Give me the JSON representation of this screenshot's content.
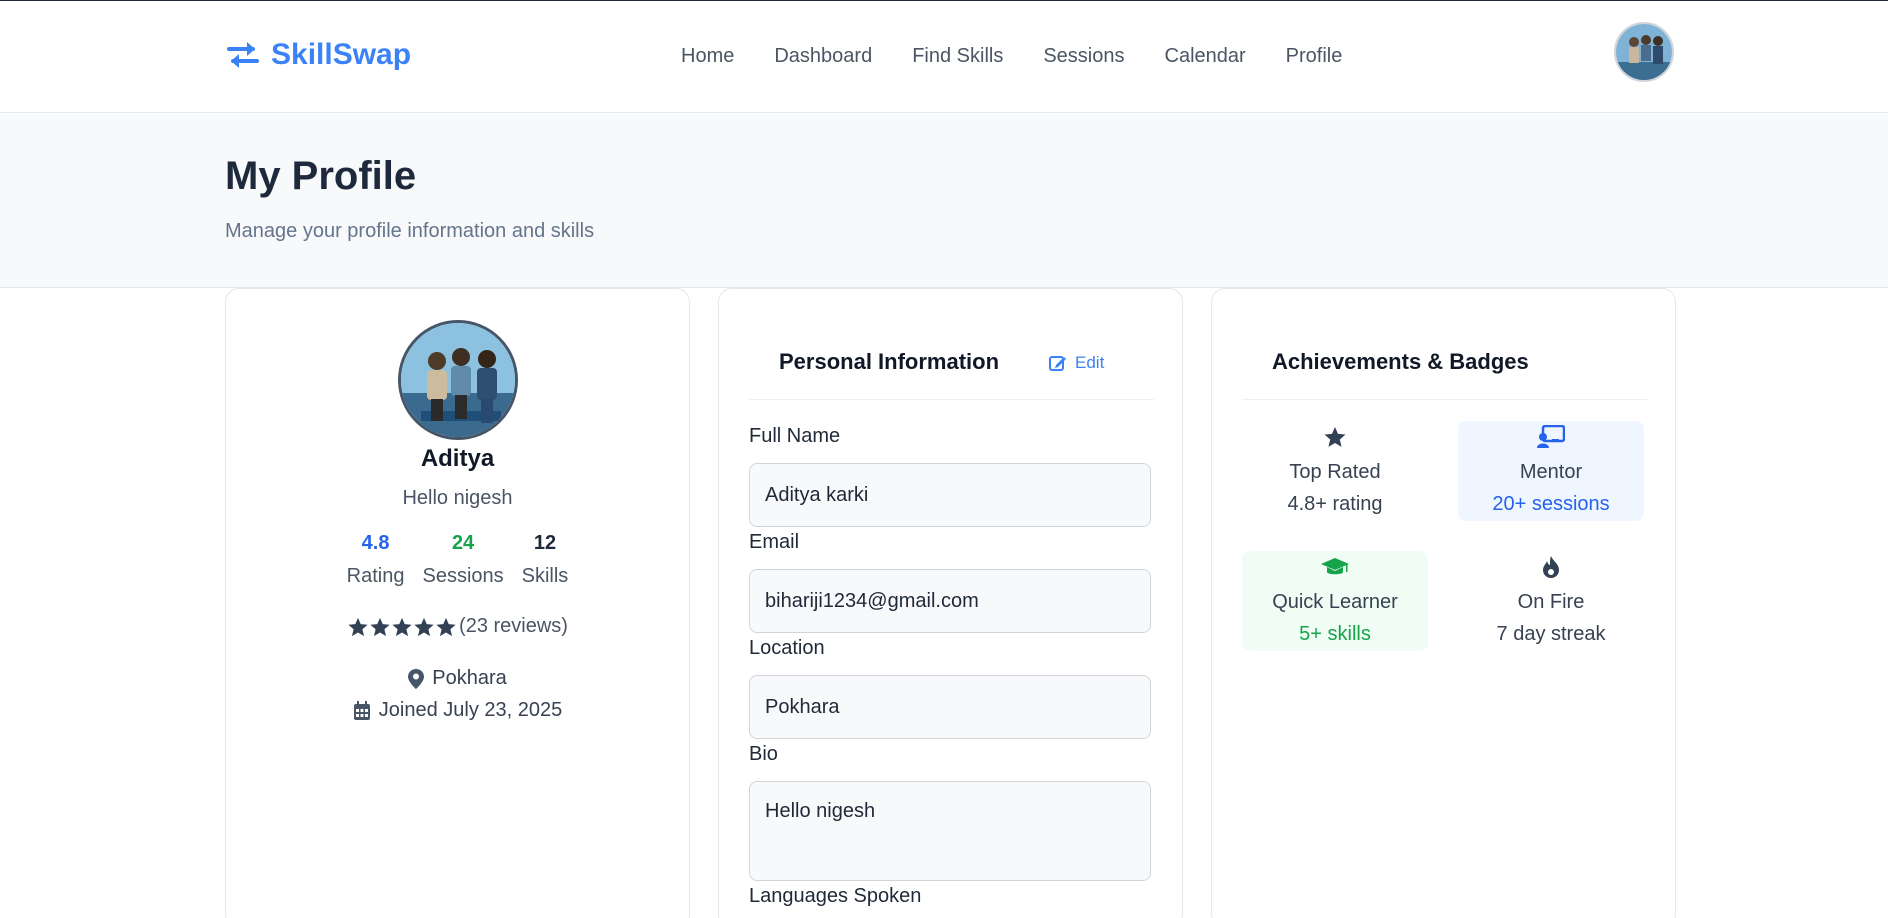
{
  "nav": {
    "brand": "SkillSwap",
    "links": [
      "Home",
      "Dashboard",
      "Find Skills",
      "Sessions",
      "Calendar",
      "Profile"
    ]
  },
  "header": {
    "title": "My Profile",
    "subtitle": "Manage your profile information and skills"
  },
  "profile": {
    "name": "Aditya",
    "bio": "Hello nigesh",
    "stats": [
      {
        "value": "4.8",
        "label": "Rating",
        "color": "#2563eb"
      },
      {
        "value": "24",
        "label": "Sessions",
        "color": "#16a34a"
      },
      {
        "value": "12",
        "label": "Skills",
        "color": "#1e293b"
      }
    ],
    "stars": 5,
    "reviews": "(23 reviews)",
    "location": "Pokhara",
    "joined": "Joined July 23, 2025"
  },
  "personal": {
    "title": "Personal Information",
    "edit_label": "Edit",
    "fields": {
      "full_name": {
        "label": "Full Name",
        "value": "Aditya karki"
      },
      "email": {
        "label": "Email",
        "value": "bihariji1234@gmail.com"
      },
      "location": {
        "label": "Location",
        "value": "Pokhara"
      },
      "bio": {
        "label": "Bio",
        "value": "Hello nigesh"
      },
      "languages": {
        "label": "Languages Spoken"
      }
    }
  },
  "achievements": {
    "title": "Achievements & Badges",
    "badges": [
      {
        "icon": "star-icon",
        "title": "Top Rated",
        "sub": "4.8+ rating",
        "bg": "#ffffff",
        "sub_color": "#374151"
      },
      {
        "icon": "chalkboard-teacher-icon",
        "title": "Mentor",
        "sub": "20+ sessions",
        "bg": "#eff6ff",
        "sub_color": "#2563eb"
      },
      {
        "icon": "graduation-cap-icon",
        "title": "Quick Learner",
        "sub": "5+ skills",
        "bg": "#f0fdf4",
        "sub_color": "#16a34a"
      },
      {
        "icon": "fire-icon",
        "title": "On Fire",
        "sub": "7 day streak",
        "bg": "#ffffff",
        "sub_color": "#374151"
      }
    ]
  },
  "colors": {
    "brand": "#3b82f6",
    "title": "#1e293b",
    "accent_blue": "#2563eb",
    "accent_green": "#16a34a"
  }
}
